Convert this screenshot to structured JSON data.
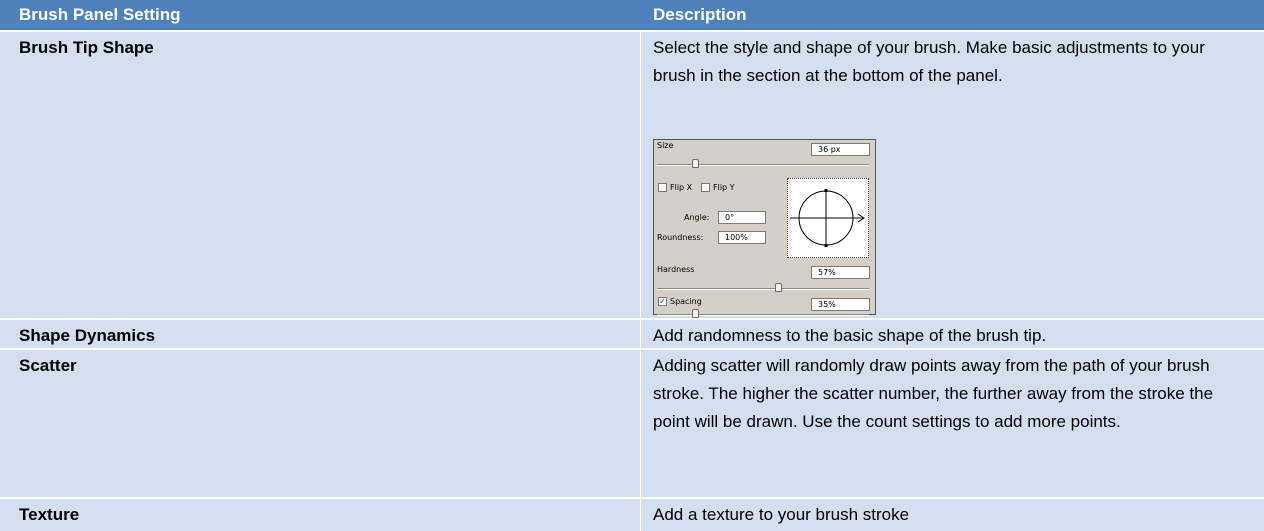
{
  "table": {
    "header": {
      "col1": "Brush Panel Setting",
      "col2": "Description"
    },
    "rows": [
      {
        "setting": "Brush Tip Shape",
        "description": "Select the style and shape of your brush.  Make basic adjustments to your brush in the section at the bottom of the panel."
      },
      {
        "setting": "Shape Dynamics",
        "description": "Add randomness to the basic shape of the brush tip."
      },
      {
        "setting": "Scatter",
        "description": "Adding scatter will randomly draw points away from the path of your brush stroke.  The higher the scatter number, the further away from the stroke the point will be drawn.  Use the count settings to add more points."
      },
      {
        "setting": "Texture",
        "description": "Add a texture to your brush stroke"
      }
    ],
    "colors": {
      "header_bg": "#4f81bd",
      "row_bg": "#d3dfee",
      "header_text": "#ffffff"
    }
  },
  "brush_panel": {
    "size_label": "Size",
    "size_value": "36 px",
    "flip_x_label": "Flip X",
    "flip_y_label": "Flip Y",
    "angle_label": "Angle:",
    "angle_value": "0°",
    "roundness_label": "Roundness:",
    "roundness_value": "100%",
    "hardness_label": "Hardness",
    "hardness_value": "57%",
    "spacing_label": "Spacing",
    "spacing_value": "35%",
    "flip_x_checked": false,
    "flip_y_checked": false,
    "spacing_checked": true,
    "size_slider_fraction": 0.18,
    "hardness_slider_fraction": 0.57,
    "spacing_slider_fraction": 0.18
  }
}
